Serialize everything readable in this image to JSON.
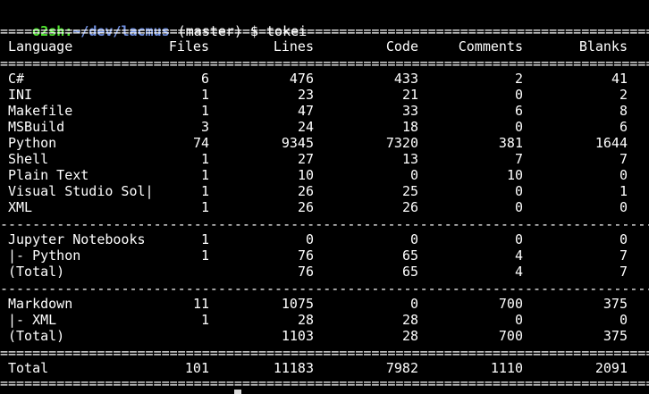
{
  "prompt": {
    "user_host": "o2sh:",
    "path": "~/dev/lacmus",
    "branch": " (master) $ ",
    "command": "tokei"
  },
  "separator_char": "=",
  "separator_minor_char": "-",
  "header": {
    "language": "Language",
    "files": "Files",
    "lines": "Lines",
    "code": "Code",
    "comments": "Comments",
    "blanks": "Blanks"
  },
  "rows": [
    {
      "language": "C#",
      "files": "6",
      "lines": "476",
      "code": "433",
      "comments": "2",
      "blanks": "41"
    },
    {
      "language": "INI",
      "files": "1",
      "lines": "23",
      "code": "21",
      "comments": "0",
      "blanks": "2"
    },
    {
      "language": "Makefile",
      "files": "1",
      "lines": "47",
      "code": "33",
      "comments": "6",
      "blanks": "8"
    },
    {
      "language": "MSBuild",
      "files": "3",
      "lines": "24",
      "code": "18",
      "comments": "0",
      "blanks": "6"
    },
    {
      "language": "Python",
      "files": "74",
      "lines": "9345",
      "code": "7320",
      "comments": "381",
      "blanks": "1644"
    },
    {
      "language": "Shell",
      "files": "1",
      "lines": "27",
      "code": "13",
      "comments": "7",
      "blanks": "7"
    },
    {
      "language": "Plain Text",
      "files": "1",
      "lines": "10",
      "code": "0",
      "comments": "10",
      "blanks": "0"
    },
    {
      "language": "Visual Studio Sol|",
      "files": "1",
      "lines": "26",
      "code": "25",
      "comments": "0",
      "blanks": "1"
    },
    {
      "language": "XML",
      "files": "1",
      "lines": "26",
      "code": "26",
      "comments": "0",
      "blanks": "0"
    }
  ],
  "jupyter": [
    {
      "language": "Jupyter Notebooks",
      "files": "1",
      "lines": "0",
      "code": "0",
      "comments": "0",
      "blanks": "0"
    },
    {
      "language": "|- Python",
      "files": "1",
      "lines": "76",
      "code": "65",
      "comments": "4",
      "blanks": "7"
    },
    {
      "language": "(Total)",
      "files": "",
      "lines": "76",
      "code": "65",
      "comments": "4",
      "blanks": "7"
    }
  ],
  "markdown": [
    {
      "language": "Markdown",
      "files": "11",
      "lines": "1075",
      "code": "0",
      "comments": "700",
      "blanks": "375"
    },
    {
      "language": "|- XML",
      "files": "1",
      "lines": "28",
      "code": "28",
      "comments": "0",
      "blanks": "0"
    },
    {
      "language": "(Total)",
      "files": "",
      "lines": "1103",
      "code": "28",
      "comments": "700",
      "blanks": "375"
    }
  ],
  "total": {
    "language": "Total",
    "files": "101",
    "lines": "11183",
    "code": "7982",
    "comments": "1110",
    "blanks": "2091"
  },
  "colors": {
    "background": "#000000",
    "text": "#ffffff",
    "prompt_user": "#4fe62f",
    "prompt_path": "#6f8fe0"
  }
}
